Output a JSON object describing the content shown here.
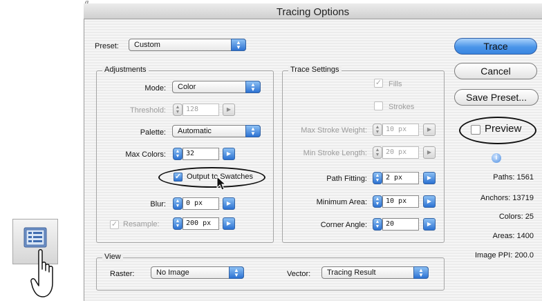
{
  "fragment_text": "g",
  "dialog": {
    "title": "Tracing Options",
    "preset": {
      "label": "Preset:",
      "value": "Custom"
    },
    "adjustments": {
      "title": "Adjustments",
      "mode": {
        "label": "Mode:",
        "value": "Color"
      },
      "threshold": {
        "label": "Threshold:",
        "value": "128"
      },
      "palette": {
        "label": "Palette:",
        "value": "Automatic"
      },
      "max_colors": {
        "label": "Max Colors:",
        "value": "32"
      },
      "output_to_swatches": {
        "label": "Output to Swatches",
        "checked": true
      },
      "blur": {
        "label": "Blur:",
        "value": "0 px"
      },
      "resample": {
        "label": "Resample:",
        "value": "200 px",
        "checked": true
      }
    },
    "trace_settings": {
      "title": "Trace Settings",
      "fills": {
        "label": "Fills",
        "checked": true
      },
      "strokes": {
        "label": "Strokes",
        "checked": false
      },
      "max_stroke_weight": {
        "label": "Max Stroke Weight:",
        "value": "10 px"
      },
      "min_stroke_length": {
        "label": "Min Stroke Length:",
        "value": "20 px"
      },
      "path_fitting": {
        "label": "Path Fitting:",
        "value": "2 px"
      },
      "minimum_area": {
        "label": "Minimum Area:",
        "value": "10 px"
      },
      "corner_angle": {
        "label": "Corner Angle:",
        "value": "20"
      }
    },
    "view": {
      "title": "View",
      "raster": {
        "label": "Raster:",
        "value": "No Image"
      },
      "vector": {
        "label": "Vector:",
        "value": "Tracing Result"
      }
    },
    "buttons": {
      "trace": "Trace",
      "cancel": "Cancel",
      "save_preset": "Save Preset..."
    },
    "preview": {
      "label": "Preview",
      "checked": false
    },
    "stats": {
      "paths": "Paths: 1561",
      "anchors": "Anchors: 13719",
      "colors": "Colors: 25",
      "areas": "Areas: 1400",
      "image_ppi": "Image PPI: 200.0"
    }
  },
  "icons": {
    "popup_arrows": "▲▼",
    "spinner_arrows": "▲▼",
    "disclosure": "▶",
    "check": "✓",
    "info": "i"
  },
  "colors": {
    "accent": "#2c72d2",
    "default_button": "#4b95e9"
  }
}
